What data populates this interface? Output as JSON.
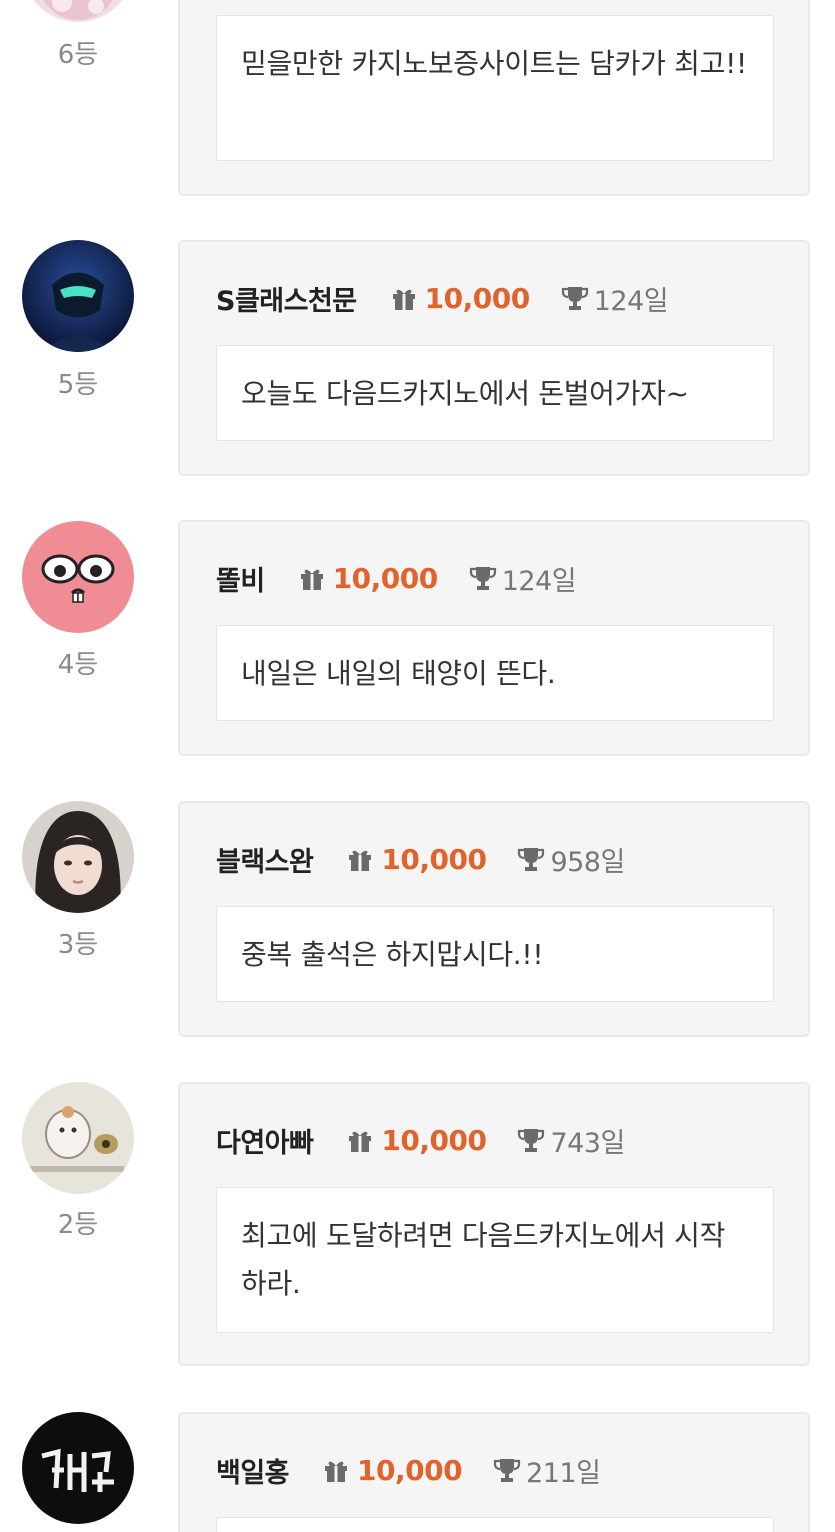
{
  "icons": {
    "points": "gift-icon",
    "days": "trophy-icon"
  },
  "colors": {
    "points": "#e2622c",
    "rank": "#8a8a8a",
    "card_bg": "#f5f5f5"
  },
  "entries": [
    {
      "rank": "6등",
      "nickname": "",
      "points": "",
      "days": "",
      "message": "믿을만한 카지노보증사이트는 담카가 최고!!"
    },
    {
      "rank": "5등",
      "nickname": "S클래스천문",
      "points": "10,000",
      "days": "124일",
      "message": "오늘도 다음드카지노에서 돈벌어가자~"
    },
    {
      "rank": "4등",
      "nickname": "똘비",
      "points": "10,000",
      "days": "124일",
      "message": "내일은 내일의 태양이 뜬다."
    },
    {
      "rank": "3등",
      "nickname": "블랙스완",
      "points": "10,000",
      "days": "958일",
      "message": "중복 출석은 하지맙시다.!!"
    },
    {
      "rank": "2등",
      "nickname": "다연아빠",
      "points": "10,000",
      "days": "743일",
      "message": "최고에 도달하려면 다음드카지노에서 시작하라."
    },
    {
      "rank": "",
      "nickname": "백일홍",
      "points": "10,000",
      "days": "211일",
      "message": ""
    }
  ]
}
